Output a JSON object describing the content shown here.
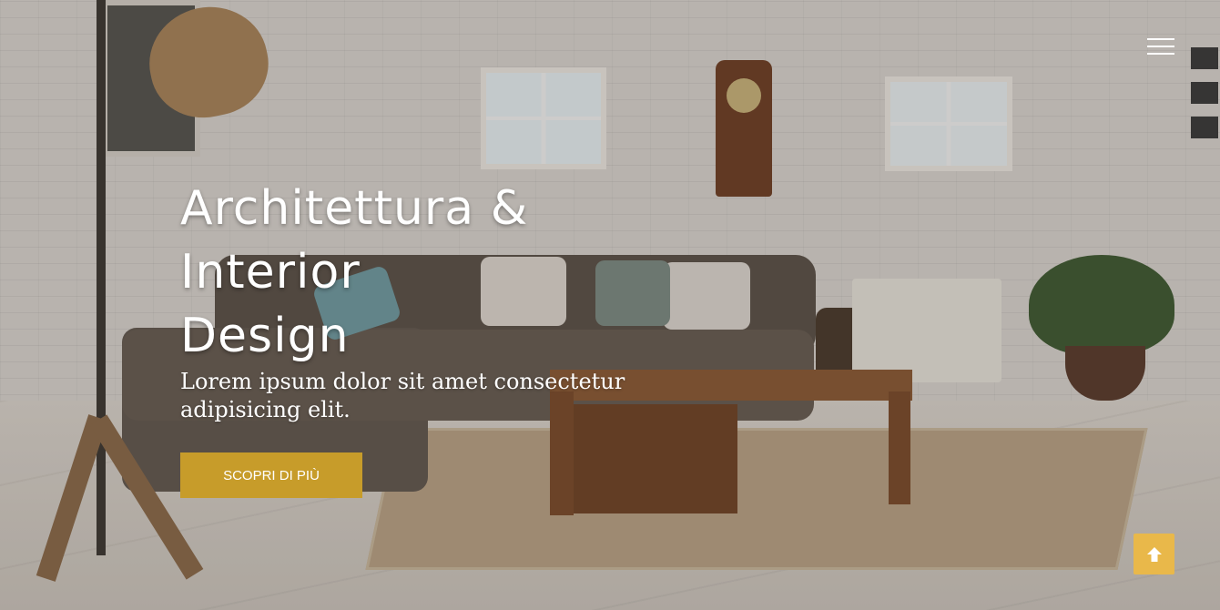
{
  "hero": {
    "title_line1": "Architettura &",
    "title_line2": "Interior",
    "title_line3": "Design",
    "subtitle": "Lorem ipsum dolor sit amet consectetur adipisicing elit.",
    "cta_label": "SCOPRI DI PIÙ"
  },
  "icons": {
    "menu": "hamburger-menu-icon",
    "back_to_top": "arrow-up-icon"
  },
  "colors": {
    "accent": "#c79c2a",
    "back_to_top": "#e9b84a",
    "text": "#ffffff"
  }
}
